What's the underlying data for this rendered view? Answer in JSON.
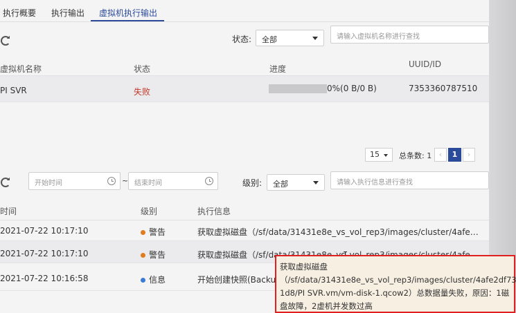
{
  "tabs": [
    {
      "label": "执行概要"
    },
    {
      "label": "执行输出"
    },
    {
      "label": "虚拟机执行输出",
      "active": true
    }
  ],
  "vm_filter": {
    "status_label": "状态:",
    "status_value": "全部",
    "search_placeholder": "请输入虚拟机名称进行查找"
  },
  "vm_table": {
    "headers": [
      "虚拟机名称",
      "状态",
      "进度",
      "UUID/ID"
    ],
    "rows": [
      {
        "name": "PI SVR",
        "status": "失败",
        "progress_fraction": 0,
        "progress_text": "0%(0 B/0 B)",
        "uuid": "7353360787510"
      }
    ]
  },
  "pagination": {
    "page_size": "15",
    "total_label": "总条数: 1",
    "current_page": "1"
  },
  "log_filter": {
    "start_placeholder": "开始时间",
    "separator": "~",
    "end_placeholder": "结束时间",
    "level_label": "级别:",
    "level_value": "全部",
    "search_placeholder": "请输入执行信息进行查找"
  },
  "log_table": {
    "headers": [
      "时间",
      "级别",
      "执行信息"
    ],
    "rows": [
      {
        "time": "2021-07-22 10:17:10",
        "level": "警告",
        "level_color": "#e07b20",
        "message": "获取虚拟磁盘（/sf/data/31431e8e_vs_vol_rep3/images/cluster/4afe…"
      },
      {
        "time": "2021-07-22 10:17:10",
        "level": "警告",
        "level_color": "#e07b20",
        "message": "获取虚拟磁盘（/sf/data/31431e8e_vs_vol_rep3/images/cluster/4afe…"
      },
      {
        "time": "2021-07-22 10:16:58",
        "level": "信息",
        "level_color": "#3a7bd5",
        "message": "开始创建快照(Backup"
      }
    ]
  },
  "tooltip": {
    "lines": [
      "获取虚拟磁盘",
      "（/sf/data/31431e8e_vs_vol_rep3/images/cluster/4afe2df73",
      "1d8/PI SVR.vm/vm-disk-1.qcow2）总数据量失败，原因：1磁",
      "盘故障，2虚机并发数过高"
    ]
  },
  "colors": {
    "accent": "#2b4a9a",
    "fail": "#c0392b",
    "warn": "#e07b20",
    "info": "#3a7bd5",
    "highlight_border": "#e02020"
  }
}
